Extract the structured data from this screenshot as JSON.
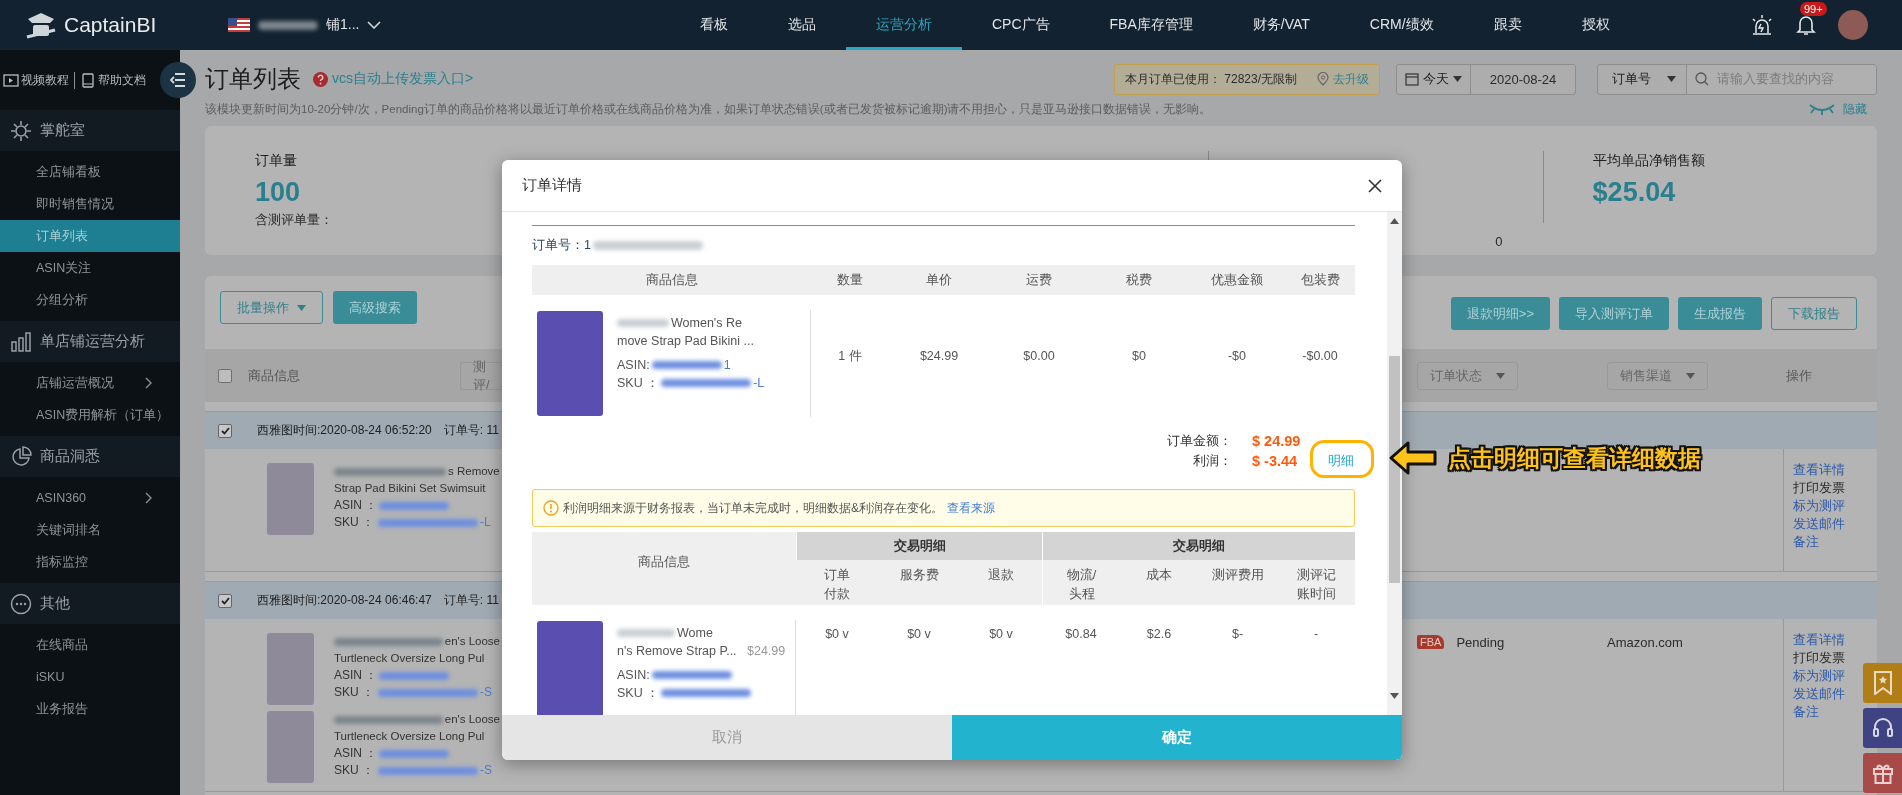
{
  "topbar": {
    "logo": "CaptainBI",
    "store": "铺1...",
    "nav": [
      {
        "label": "看板",
        "selected": false
      },
      {
        "label": "选品",
        "selected": false
      },
      {
        "label": "运营分析",
        "selected": true
      },
      {
        "label": "CPC广告",
        "selected": false
      },
      {
        "label": "FBA库存管理",
        "selected": false
      },
      {
        "label": "财务/VAT",
        "selected": false
      },
      {
        "label": "CRM/绩效",
        "selected": false
      },
      {
        "label": "跟卖",
        "selected": false
      },
      {
        "label": "授权",
        "selected": false
      }
    ],
    "notification_badge": "99+"
  },
  "sidebar": {
    "links": [
      {
        "label": "视频教程"
      },
      {
        "label": "帮助文档"
      }
    ],
    "sections": [
      {
        "title": "掌舵室",
        "items": [
          {
            "label": "全店铺看板",
            "selected": false,
            "has_arrow": false
          },
          {
            "label": "即时销售情况",
            "selected": false,
            "has_arrow": false
          },
          {
            "label": "订单列表",
            "selected": true,
            "has_arrow": false
          },
          {
            "label": "ASIN关注",
            "selected": false,
            "has_arrow": false
          },
          {
            "label": "分组分析",
            "selected": false,
            "has_arrow": false
          }
        ]
      },
      {
        "title": "单店铺运营分析",
        "items": [
          {
            "label": "店铺运营概况",
            "selected": false,
            "has_arrow": true
          },
          {
            "label": "ASIN费用解析（订单）",
            "selected": false,
            "has_arrow": false
          }
        ]
      },
      {
        "title": "商品洞悉",
        "items": [
          {
            "label": "ASIN360",
            "selected": false,
            "has_arrow": true
          },
          {
            "label": "关键词排名",
            "selected": false,
            "has_arrow": false
          },
          {
            "label": "指标监控",
            "selected": false,
            "has_arrow": false
          }
        ]
      },
      {
        "title": "其他",
        "items": [
          {
            "label": "在线商品",
            "selected": false,
            "has_arrow": false
          },
          {
            "label": "iSKU",
            "selected": false,
            "has_arrow": false
          },
          {
            "label": "业务报告",
            "selected": false,
            "has_arrow": false
          }
        ]
      }
    ]
  },
  "page": {
    "title": "订单列表",
    "help_link": "vcs自动上传发票入口>",
    "notice": "该模块更新时间为10-20分钟/次，Pending订单的商品价格将以最近订单价格或在线商品价格为准，如果订单状态错误(或者已发货被标记逾期)请不用担心，只是亚马逊接口数据错误，无影响。",
    "hide": "隐藏",
    "quota": "本月订单已使用： 72823/无限制",
    "upgrade": "去升级",
    "date_range": "今天",
    "date": "2020-08-24",
    "search_field": "订单号",
    "search_placeholder": "请输入要查找的内容"
  },
  "stats": [
    {
      "label": "订单量",
      "value": "100",
      "sub": "含测评单量："
    },
    {
      "sub_value": "0"
    },
    {
      "label": "平均单品净销售额",
      "value": "$25.04"
    }
  ],
  "toolbar": {
    "left": [
      {
        "label": "批量操作",
        "kind": "outline",
        "dropdown": true
      },
      {
        "label": "高级搜索",
        "kind": "filled",
        "dropdown": false
      }
    ],
    "right": [
      {
        "label": "退款明细>>",
        "kind": "filled",
        "dropdown": false
      },
      {
        "label": "导入测评订单",
        "kind": "filled",
        "dropdown": false
      },
      {
        "label": "生成报告",
        "kind": "filled",
        "dropdown": false
      },
      {
        "label": "下载报告",
        "kind": "outline",
        "dropdown": false
      }
    ]
  },
  "table": {
    "select_all": false,
    "columns": [
      {
        "label": "商品信息",
        "kind": "text"
      },
      {
        "label": "测评/",
        "kind": "select"
      },
      {
        "label": "订单状态",
        "kind": "select"
      },
      {
        "label": "销售渠道",
        "kind": "select"
      },
      {
        "label": "操作",
        "kind": "text"
      }
    ],
    "orders": [
      {
        "checked": true,
        "time": "西雅图时间:2020-08-24 06:52:20",
        "order_no": "订单号: 11",
        "items": [
          {
            "title_lines": [
              "s Remove",
              "Strap Pad Bikini Set Swimsuit"
            ],
            "asin_label": "ASIN ：",
            "sku_label": "SKU ：",
            "sku_suffix": "-L"
          }
        ],
        "actions": [
          {
            "label": "查看详情",
            "kind": "link"
          },
          {
            "label": "打印发票",
            "kind": "text"
          },
          {
            "label": "标为测评",
            "kind": "link"
          },
          {
            "label": "发送邮件",
            "kind": "link"
          },
          {
            "label": "备注",
            "kind": "link"
          }
        ]
      },
      {
        "checked": true,
        "time": "西雅图时间:2020-08-24 06:46:47",
        "order_no": "订单号: 11",
        "fulfillment": "FBA",
        "status": "Pending",
        "channel": "Amazon.com",
        "items": [
          {
            "title_lines": [
              "en's Loose",
              "Turtleneck Oversize Long Pul"
            ],
            "asin_label": "ASIN ：",
            "sku_label": "SKU ：",
            "sku_suffix": "-S"
          },
          {
            "title_lines": [
              "en's Loose",
              "Turtleneck Oversize Long Pul"
            ],
            "asin_label": "ASIN ：",
            "sku_label": "SKU ：",
            "sku_suffix": "-S"
          }
        ],
        "actions": [
          {
            "label": "查看详情",
            "kind": "link"
          },
          {
            "label": "打印发票",
            "kind": "text"
          },
          {
            "label": "标为测评",
            "kind": "link"
          },
          {
            "label": "发送邮件",
            "kind": "link"
          },
          {
            "label": "备注",
            "kind": "link"
          }
        ]
      }
    ]
  },
  "modal": {
    "title": "订单详情",
    "order_no": "订单号：1",
    "product_column": "商品信息",
    "columns": [
      "数量",
      "单价",
      "运费",
      "税费",
      "优惠金额",
      "包装费"
    ],
    "rows": [
      {
        "title_lines": [
          "Women's Re",
          "move Strap Pad Bikini ..."
        ],
        "asin_label": "ASIN:",
        "asin_suffix": "1",
        "sku_label": "SKU ：",
        "sku_suffix": "-L",
        "cells": [
          "1 件",
          "$24.99",
          "$0.00",
          "$0",
          "-$0",
          "-$0.00"
        ]
      }
    ],
    "totals": [
      {
        "label": "订单金额：",
        "value": "$ 24.99"
      },
      {
        "label": "利润：",
        "value": "$ -3.44",
        "link": "明细"
      }
    ],
    "notice": {
      "text": "利润明细来源于财务报表，当订单未完成时，明细数据&利润存在变化。",
      "link": "查看来源"
    },
    "detail_table": {
      "product_header": "商品信息",
      "groups": [
        {
          "label": "交易明细",
          "columns": [
            "订单付款",
            "服务费",
            "退款"
          ]
        },
        {
          "label": "交易明细",
          "columns": [
            "物流/头程",
            "成本",
            "测评费用",
            "测评记账时间"
          ]
        }
      ],
      "rows": [
        {
          "title_lines": [
            "Wome",
            "n's Remove Strap P..."
          ],
          "price": "$24.99",
          "asin_label": "ASIN:",
          "sku_label": "SKU ：",
          "cells": [
            "$0 v",
            "$0 v",
            "$0 v",
            "$0.84",
            "$2.6",
            "$-",
            "-"
          ]
        }
      ]
    },
    "buttons": [
      {
        "label": "取消",
        "kind": "secondary"
      },
      {
        "label": "确定",
        "kind": "primary"
      }
    ]
  },
  "annotation": {
    "text": "点击明细可查看详细数据"
  }
}
